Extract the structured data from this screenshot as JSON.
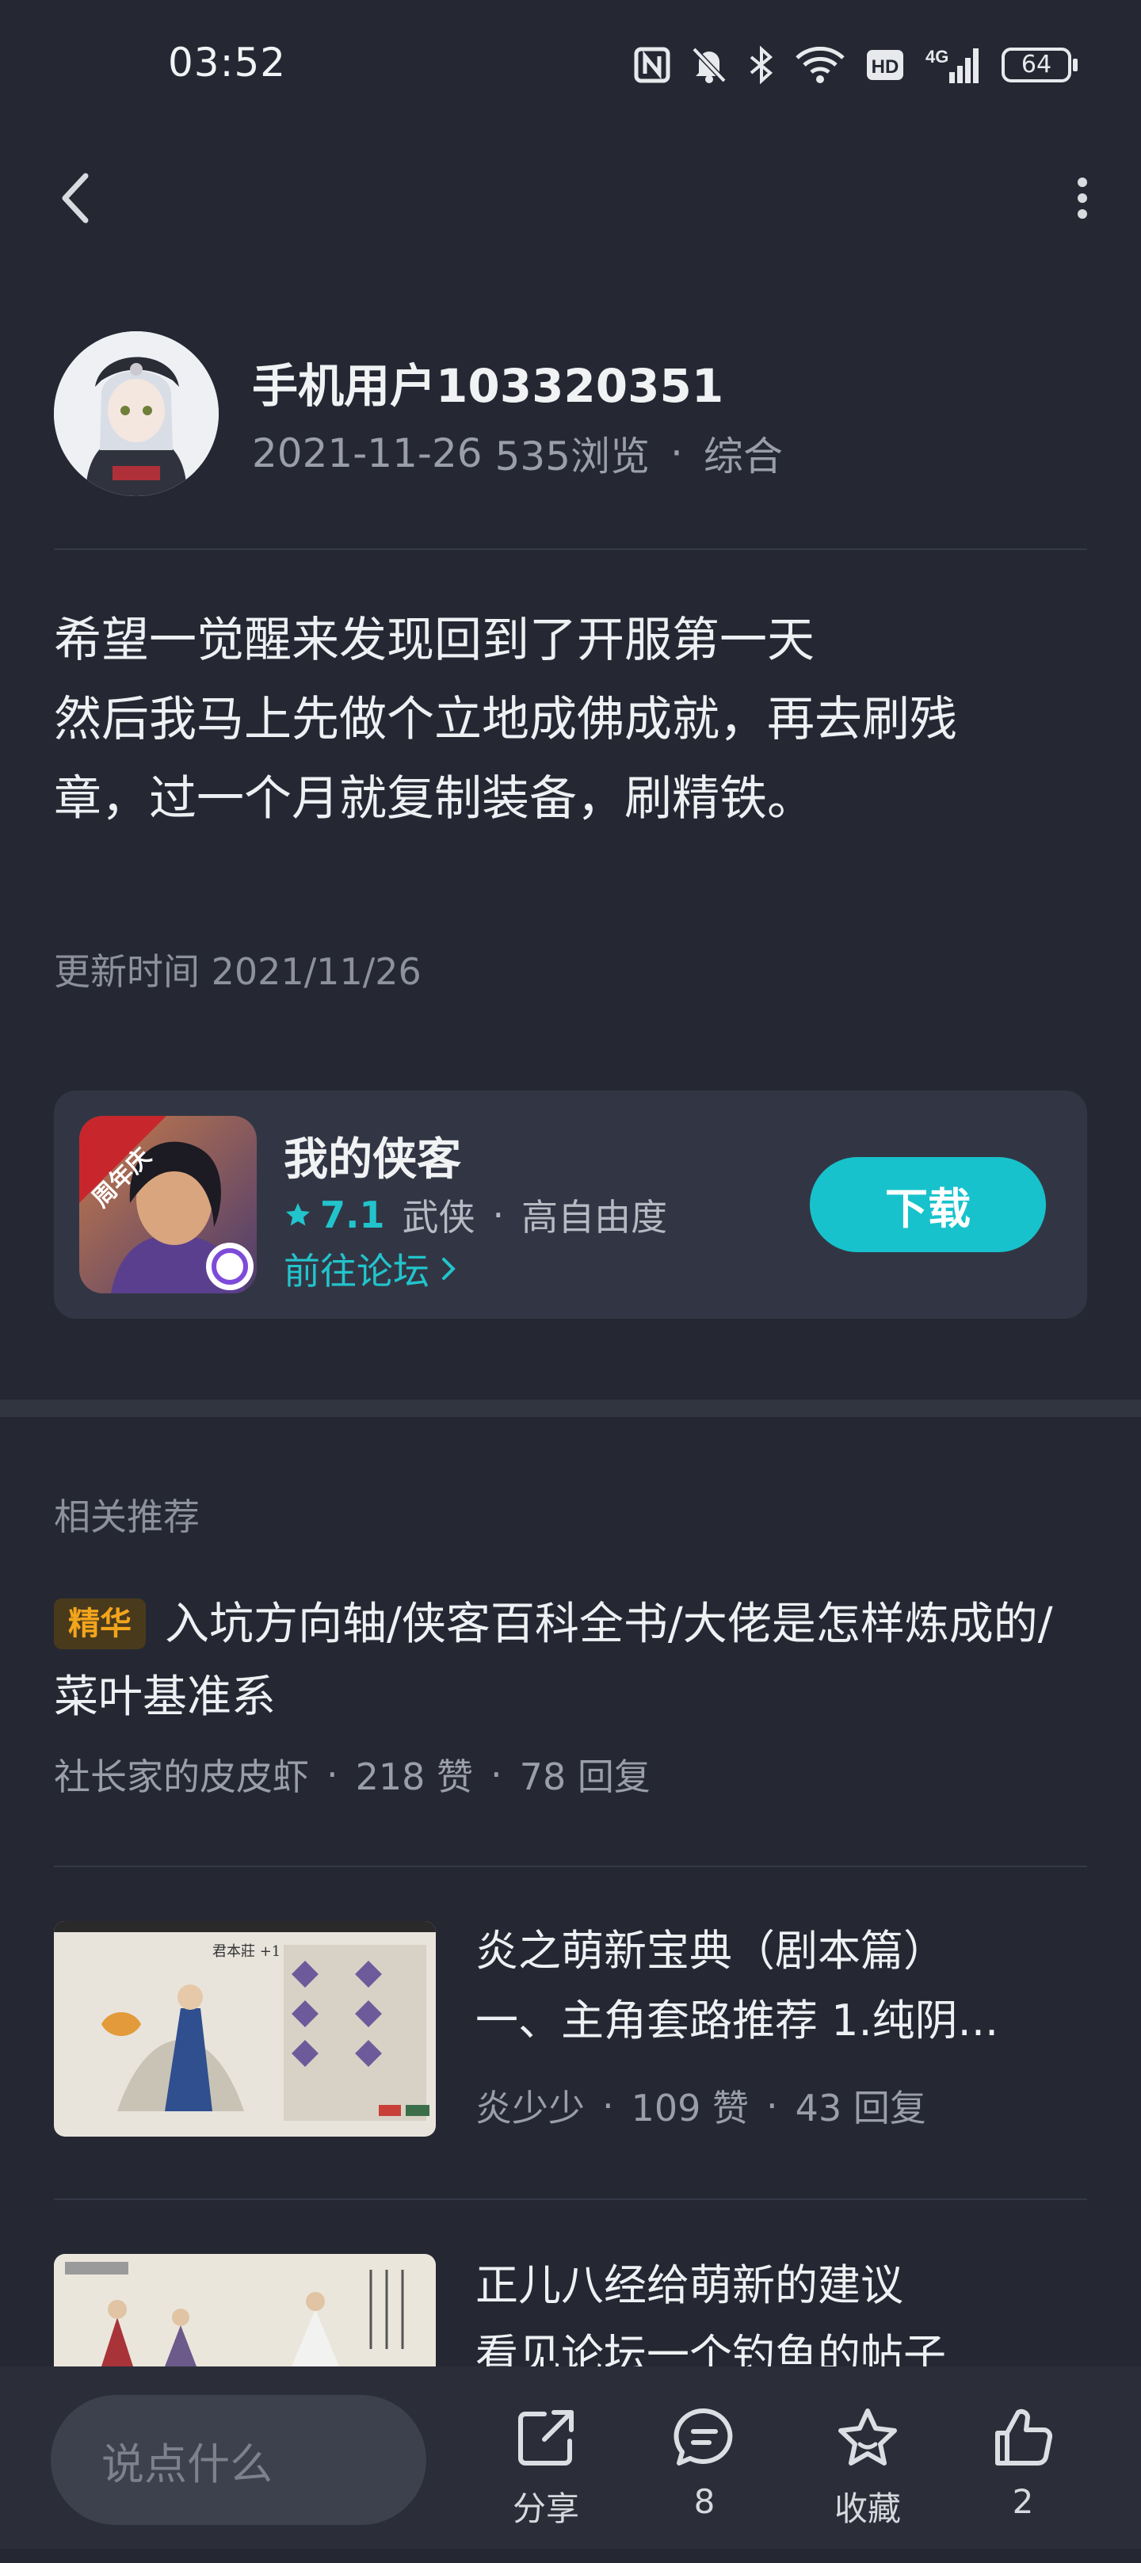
{
  "status_bar": {
    "time": "03:52",
    "battery": "64",
    "network": "4G",
    "icons": [
      "nfc-icon",
      "mute-icon",
      "bluetooth-icon",
      "wifi-icon",
      "hd-icon",
      "signal-icon",
      "battery-icon"
    ]
  },
  "nav": {
    "back_icon": "chevron-left-icon",
    "more_icon": "more-vertical-icon"
  },
  "author": {
    "name": "手机用户103320351",
    "date": "2021-11-26",
    "views": "535浏览",
    "separator": "·",
    "category": "综合"
  },
  "post": {
    "lines": [
      "希望一觉醒来发现回到了开服第一天",
      "然后我马上先做个立地成佛成就，再去刷残",
      "章，过一个月就复制装备，刷精铁。"
    ],
    "update_time": "更新时间 2021/11/26"
  },
  "game": {
    "icon_badge": "周年庆",
    "name": "我的侠客",
    "rating": "7.1",
    "tag1": "武侠",
    "separator": "·",
    "tag2": "高自由度",
    "forum_link": "前往论坛",
    "download": "下载"
  },
  "related": {
    "title": "相关推荐",
    "items": [
      {
        "badge": "精华",
        "title": "入坑方向轴/侠客百科全书/大佬是怎样炼成的/菜叶基准系",
        "author": "社长家的皮皮虾",
        "likes": "218 赞",
        "replies": "78 回复"
      },
      {
        "title_line1": "炎之萌新宝典（剧本篇）",
        "title_line2": "一、主角套路推荐 1.纯阴...",
        "author": "炎少少",
        "likes": "109 赞",
        "replies": "43 回复",
        "thumb_caption": "君本莊 +1"
      },
      {
        "title_line1": "正儿八经给萌新的建议",
        "title_line2": "看见论坛一个钓鱼的帖子"
      }
    ],
    "separator": "·"
  },
  "bottom_bar": {
    "input_placeholder": "说点什么",
    "share_label": "分享",
    "comment_count": "8",
    "favorite_label": "收藏",
    "like_count": "2"
  },
  "colors": {
    "background": "#252833",
    "card": "#323644",
    "accent": "#18c2cc",
    "badge_text": "#f3a51c"
  }
}
